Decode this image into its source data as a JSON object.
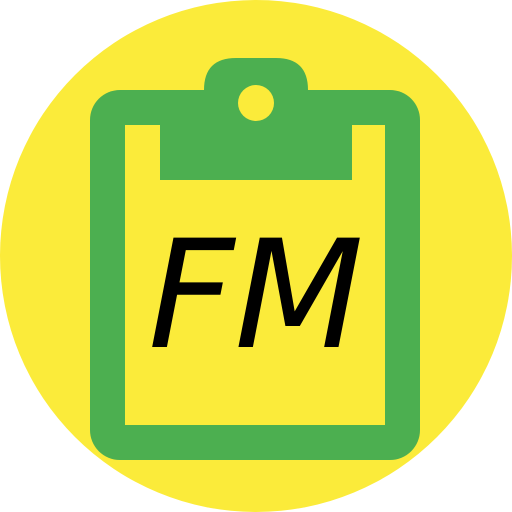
{
  "icon": {
    "name": "clipboard-icon",
    "label": "FM",
    "colors": {
      "background_circle": "#FBEB3A",
      "clipboard_green": "#4CAF50",
      "label_text": "#000000",
      "page_background": "#FFFFFF"
    }
  }
}
